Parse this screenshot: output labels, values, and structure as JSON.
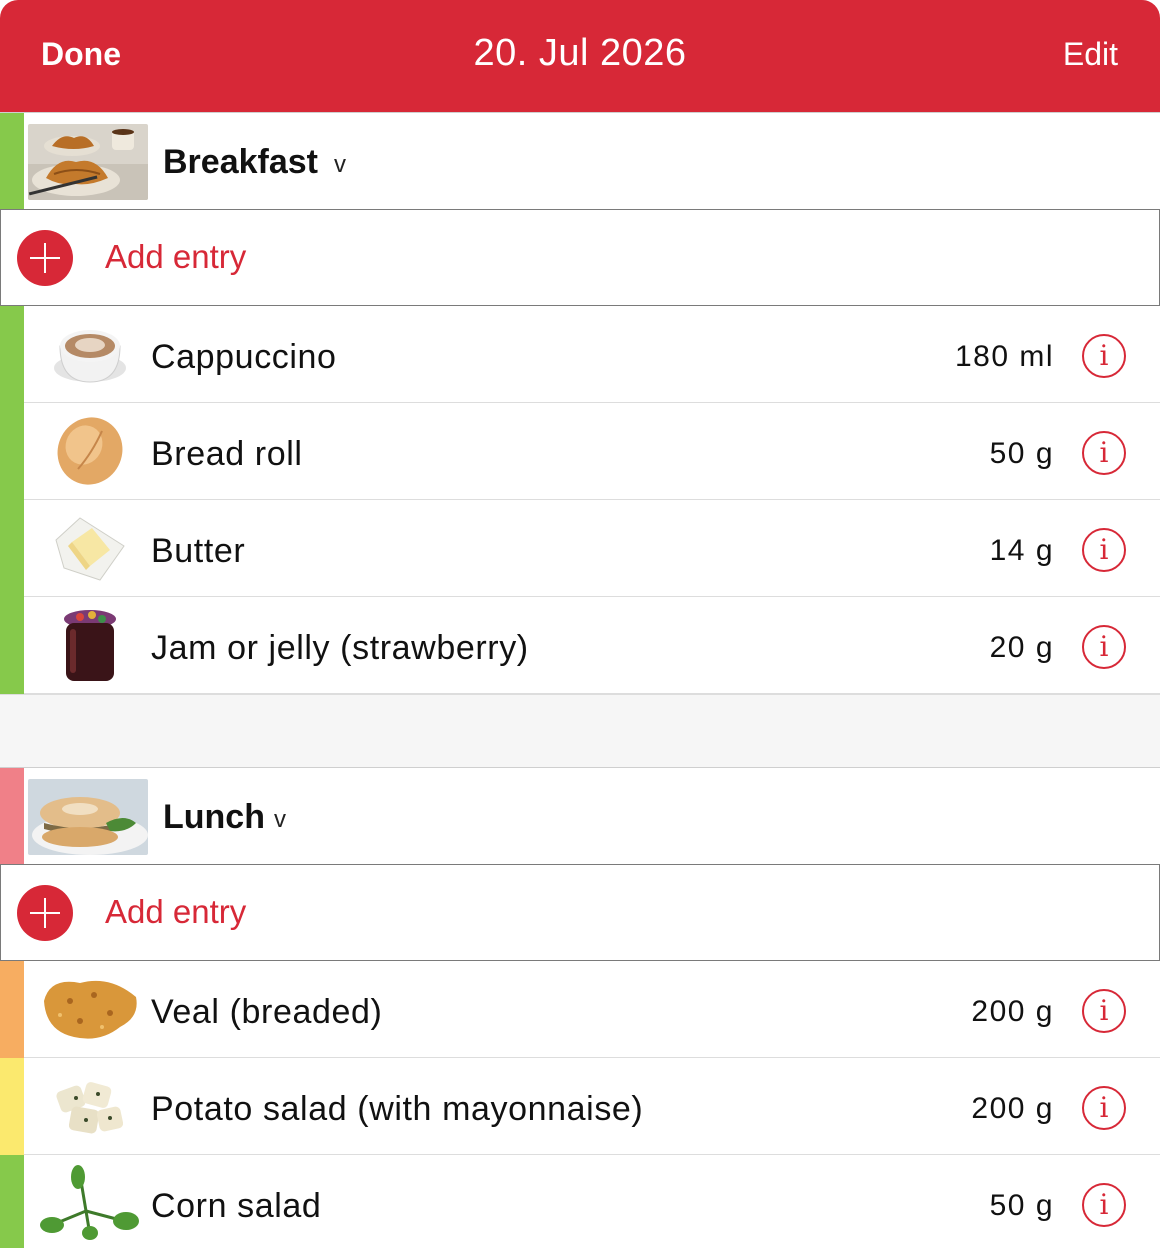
{
  "nav": {
    "left_label": "Done",
    "title": "20. Jul 2026",
    "right_label": "Edit"
  },
  "colors": {
    "accent": "#d72837",
    "green": "#86c94b",
    "red": "#f08088",
    "orange": "#f7ad61",
    "yellow": "#fbe96e"
  },
  "meals": [
    {
      "title": "Breakfast",
      "chevron": "v",
      "bar_color": "#86c94b",
      "add_label": "Add entry",
      "entries": [
        {
          "name": "Cappuccino",
          "amount": "180 ml",
          "icon": "cappuccino-icon",
          "bar_color": "#86c94b"
        },
        {
          "name": "Bread roll",
          "amount": "50 g",
          "icon": "bread-roll-icon",
          "bar_color": "#86c94b"
        },
        {
          "name": "Butter",
          "amount": "14 g",
          "icon": "butter-icon",
          "bar_color": "#86c94b"
        },
        {
          "name": "Jam or jelly (strawberry)",
          "amount": "20 g",
          "icon": "jam-jar-icon",
          "bar_color": "#86c94b"
        }
      ]
    },
    {
      "title": "Lunch",
      "chevron": "v",
      "bar_color": "#f08088",
      "add_label": "Add entry",
      "entries": [
        {
          "name": "Veal (breaded)",
          "amount": "200 g",
          "icon": "breaded-veal-icon",
          "bar_color": "#f7ad61"
        },
        {
          "name": "Potato salad (with mayonnaise)",
          "amount": "200 g",
          "icon": "potato-salad-icon",
          "bar_color": "#fbe96e"
        },
        {
          "name": "Corn salad",
          "amount": "50 g",
          "icon": "corn-salad-icon",
          "bar_color": "#86c94b"
        }
      ]
    }
  ],
  "info_glyph": "i"
}
